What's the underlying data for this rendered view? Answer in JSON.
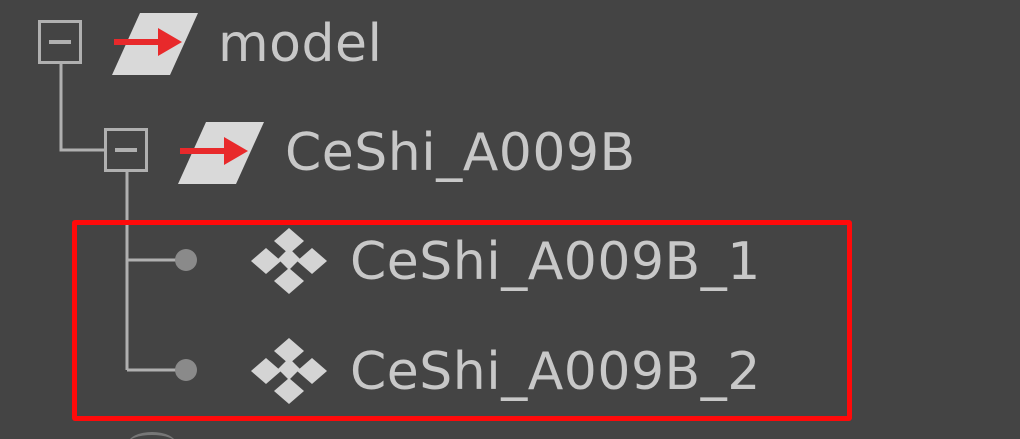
{
  "outliner": {
    "items": [
      {
        "label": "model",
        "type": "group",
        "expanded": true,
        "icon": "group-transform-icon"
      },
      {
        "label": "CeShi_A009B",
        "type": "group",
        "expanded": true,
        "icon": "group-transform-icon"
      },
      {
        "label": "CeShi_A009B_1",
        "type": "mesh",
        "icon": "mesh-shape-icon"
      },
      {
        "label": "CeShi_A009B_2",
        "type": "mesh",
        "icon": "mesh-shape-icon"
      }
    ]
  },
  "colors": {
    "background": "#444444",
    "text": "#c8c8c8",
    "connector": "#b0b0b0",
    "arrow": "#e8292b",
    "highlight": "#ff0a0a"
  }
}
